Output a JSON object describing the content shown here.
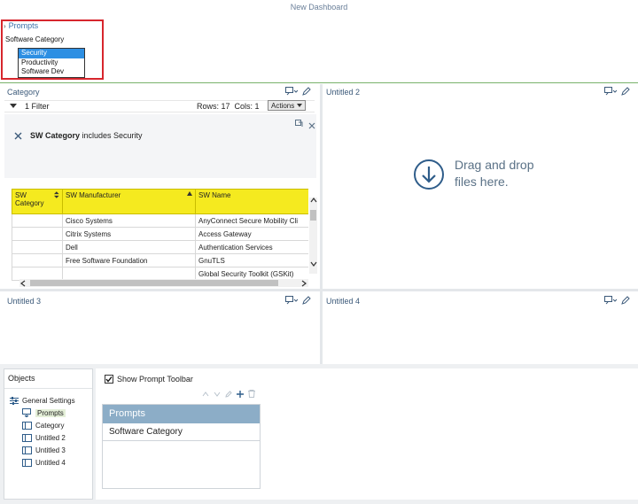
{
  "dashboard": {
    "title": "New Dashboard"
  },
  "prompts": {
    "header": "Prompts",
    "label": "Software Category",
    "options": [
      "Security",
      "Productivity",
      "Software Dev"
    ],
    "selected": "Security"
  },
  "category_panel": {
    "title": "Category",
    "filter_count": "1 Filter",
    "rows": "Rows: 17",
    "cols": "Cols: 1",
    "actions_label": "Actions",
    "filter_field": "SW Category",
    "filter_rest": " includes Security",
    "table": {
      "headers": [
        "SW Category",
        "SW Manufacturer",
        "SW Name"
      ],
      "rows": [
        [
          "",
          "Cisco Systems",
          "AnyConnect Secure Mobility Cli"
        ],
        [
          "",
          "Citrix Systems",
          "Access Gateway"
        ],
        [
          "",
          "Dell",
          "Authentication Services"
        ],
        [
          "",
          "Free Software Foundation",
          "GnuTLS"
        ],
        [
          "",
          "",
          "Global Security Toolkit (GSKit)"
        ]
      ]
    }
  },
  "untitled2": {
    "title": "Untitled 2",
    "drop_line1": "Drag and drop",
    "drop_line2": "files here."
  },
  "untitled3": {
    "title": "Untitled 3"
  },
  "untitled4": {
    "title": "Untitled 4"
  },
  "objects": {
    "title": "Objects",
    "items": [
      "General Settings",
      "Prompts",
      "Category",
      "Untitled 2",
      "Untitled 3",
      "Untitled 4"
    ]
  },
  "prompt_toolbar": {
    "show_label": "Show Prompt Toolbar",
    "checked": true,
    "list_header": "Prompts",
    "list_items": [
      "Software Category"
    ]
  },
  "colors": {
    "accent": "#2d8fe3",
    "header_yellow": "#f5ea1f",
    "highlight_border": "#d7262d",
    "prompt_header": "#8cadc7"
  }
}
